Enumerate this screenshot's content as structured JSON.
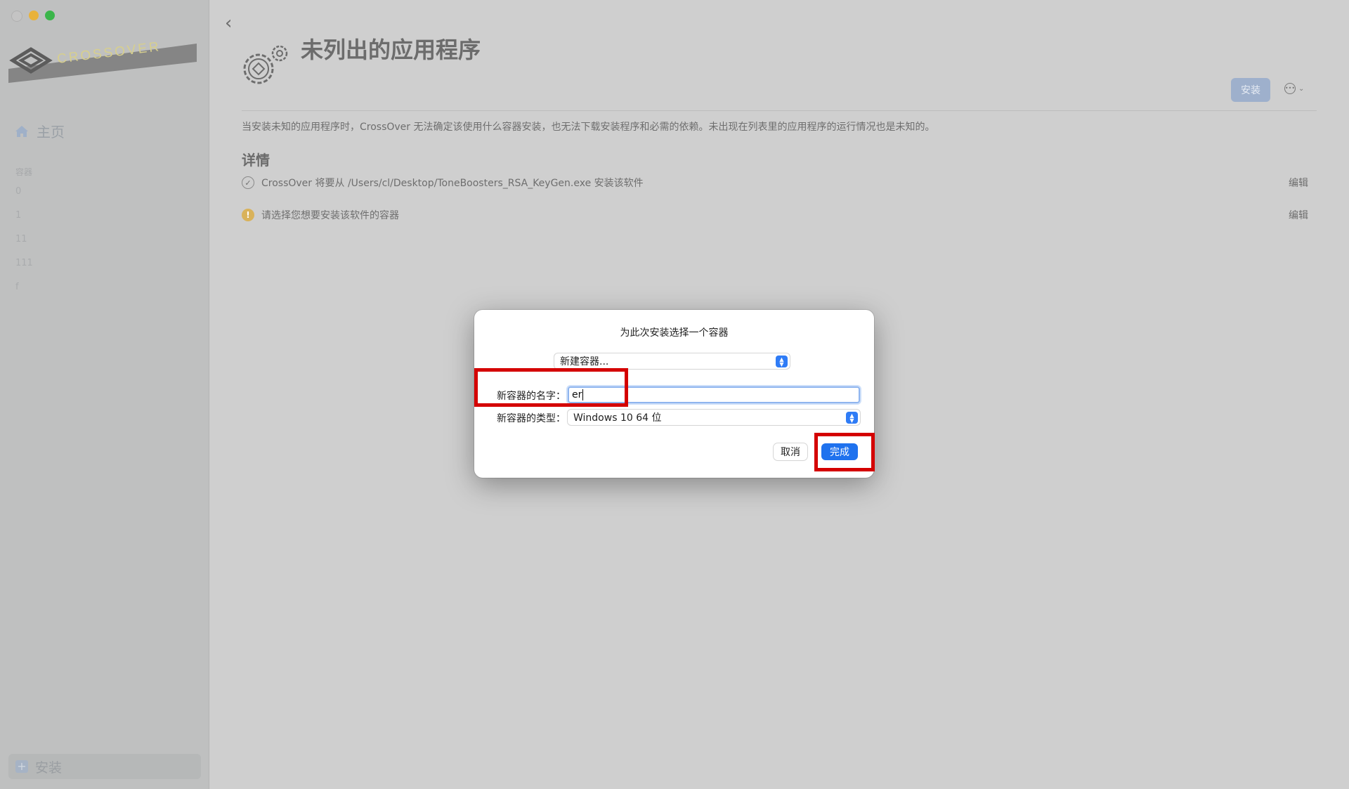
{
  "window": {
    "traffic_lights": [
      "close",
      "minimize",
      "maximize"
    ]
  },
  "sidebar": {
    "logo_text": "CROSSOVER",
    "home_label": "主页",
    "containers_label": "容器",
    "containers": [
      "0",
      "1",
      "11",
      "111",
      "f"
    ],
    "install_label": "安装"
  },
  "header": {
    "title": "未列出的应用程序",
    "install_button": "安装",
    "more_icon": "ellipsis-circle-icon"
  },
  "main": {
    "description": "当安装未知的应用程序时，CrossOver 无法确定该使用什么容器安装，也无法下载安装程序和必需的依赖。未出现在列表里的应用程序的运行情况也是未知的。",
    "details_title": "详情",
    "details": [
      {
        "icon": "checkmark-circle-icon",
        "text": "CrossOver 将要从 /Users/cl/Desktop/ToneBoosters_RSA_KeyGen.exe 安装该软件",
        "edit": "编辑"
      },
      {
        "icon": "warning-icon",
        "text": "请选择您想要安装该软件的容器",
        "edit": "编辑"
      }
    ]
  },
  "dialog": {
    "title": "为此次安装选择一个容器",
    "container_select": "新建容器...",
    "name_label": "新容器的名字：",
    "name_value": "er",
    "type_label": "新容器的类型：",
    "type_value": "Windows 10 64 位",
    "cancel": "取消",
    "done": "完成"
  },
  "colors": {
    "accent": "#1f72ee",
    "highlight": "#d40000",
    "warning": "#d9b25a"
  }
}
